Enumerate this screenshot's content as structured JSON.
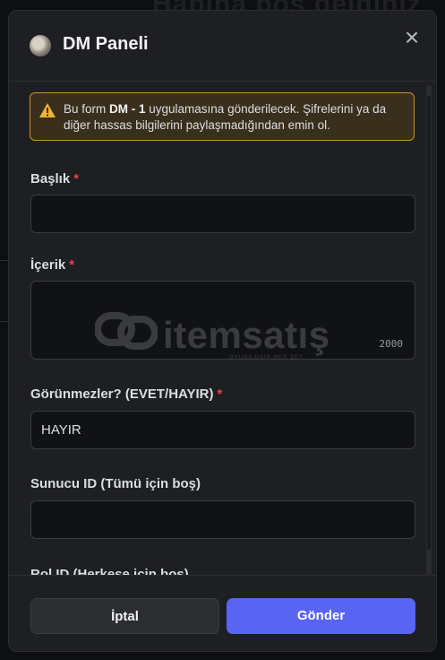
{
  "background": {
    "text": "Hapına boş geldiniz"
  },
  "modal": {
    "title": "DM Paneli",
    "close_icon": "close-icon"
  },
  "warning": {
    "prefix": "Bu form ",
    "app_name": "DM - 1",
    "suffix": " uygulamasına gönderilecek. Şifrelerini ya da diğer hassas bilgilerini paylaşmadığından emin ol."
  },
  "fields": {
    "title": {
      "label": "Başlık",
      "required_mark": "*",
      "value": ""
    },
    "content": {
      "label": "İçerik",
      "required_mark": "*",
      "value": "",
      "counter": "2000"
    },
    "invisible": {
      "label": "Görünmezler? (EVET/HAYIR)",
      "required_mark": "*",
      "value": "HAYIR"
    },
    "server_id": {
      "label": "Sunucu ID (Tümü için boş)",
      "value": ""
    },
    "role_id": {
      "label": "Rol ID (Herkese için boş)"
    }
  },
  "watermark": {
    "text": "itemsatış",
    "subtext": "OYUNA DAİR HER ŞEY"
  },
  "footer": {
    "cancel_label": "İptal",
    "submit_label": "Gönder"
  },
  "colors": {
    "accent": "#5865f2",
    "warning_border": "#c8962d",
    "required": "#f23f43"
  }
}
